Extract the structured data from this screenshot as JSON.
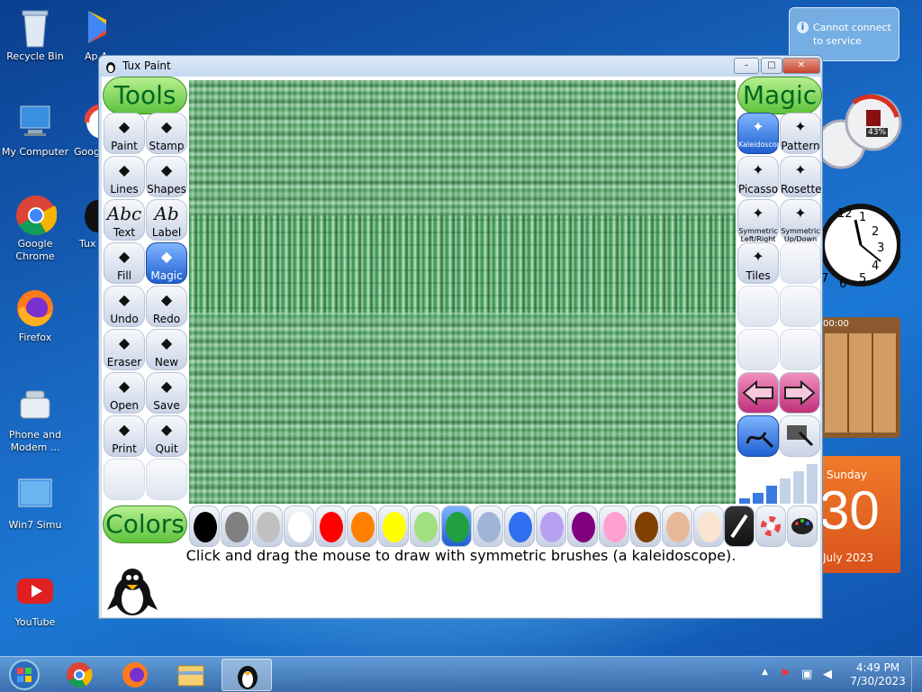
{
  "desktop": {
    "icons": [
      {
        "label": "Recycle Bin",
        "icon": "recycle-bin-icon"
      },
      {
        "label": "My Computer",
        "icon": "computer-icon"
      },
      {
        "label": "Google Chrome",
        "icon": "chrome-icon"
      },
      {
        "label": "Firefox",
        "icon": "firefox-icon"
      },
      {
        "label": "Phone and Modem ...",
        "icon": "phone-icon"
      },
      {
        "label": "Win7 Simu",
        "icon": "win7-icon"
      },
      {
        "label": "YouTube",
        "icon": "youtube-icon"
      },
      {
        "label": "Ap And",
        "icon": "play-store-icon"
      },
      {
        "label": "Goog",
        "icon": "google-icon"
      },
      {
        "label": "Tux",
        "icon": "tux-icon"
      }
    ],
    "notification": "Cannot connect to service",
    "gadgets": {
      "meter_value": "43%",
      "puzzle_time": "00:00",
      "calendar": {
        "weekday": "Sunday",
        "day": "30",
        "month_year": "July 2023"
      },
      "clock_numbers": [
        "12",
        "1",
        "2",
        "3",
        "4",
        "5",
        "6",
        "7"
      ]
    }
  },
  "window": {
    "title": "Tux Paint",
    "controls": {
      "minimize": "–",
      "maximize": "□",
      "close": "✕"
    }
  },
  "tools": {
    "header": "Tools",
    "items": [
      {
        "label": "Paint",
        "icon": "paint-brush-icon"
      },
      {
        "label": "Stamp",
        "icon": "stamp-icon"
      },
      {
        "label": "Lines",
        "icon": "lines-icon"
      },
      {
        "label": "Shapes",
        "icon": "shapes-icon"
      },
      {
        "label": "Text",
        "icon": "text-icon",
        "glyph": "Abc"
      },
      {
        "label": "Label",
        "icon": "label-icon",
        "glyph": "Ab"
      },
      {
        "label": "Fill",
        "icon": "fill-bucket-icon"
      },
      {
        "label": "Magic",
        "icon": "magic-wand-icon",
        "selected": true
      },
      {
        "label": "Undo",
        "icon": "undo-icon"
      },
      {
        "label": "Redo",
        "icon": "redo-icon"
      },
      {
        "label": "Eraser",
        "icon": "eraser-icon"
      },
      {
        "label": "New",
        "icon": "new-icon"
      },
      {
        "label": "Open",
        "icon": "open-icon"
      },
      {
        "label": "Save",
        "icon": "save-icon"
      },
      {
        "label": "Print",
        "icon": "print-icon"
      },
      {
        "label": "Quit",
        "icon": "quit-icon"
      }
    ]
  },
  "magic": {
    "header": "Magic",
    "items": [
      {
        "label": "Kaleidoscope",
        "icon": "kaleidoscope-icon",
        "selected": true
      },
      {
        "label": "Pattern",
        "icon": "pattern-icon"
      },
      {
        "label": "Picasso",
        "icon": "picasso-icon"
      },
      {
        "label": "Rosette",
        "icon": "rosette-icon"
      },
      {
        "label": "Symmetric Left/Right",
        "icon": "symmetric-left-right-icon"
      },
      {
        "label": "Symmetric Up/Down",
        "icon": "symmetric-up-down-icon"
      },
      {
        "label": "Tiles",
        "icon": "tiles-icon"
      }
    ]
  },
  "colors": {
    "header": "Colors",
    "swatches": [
      "#000000",
      "#808080",
      "#c0c0c0",
      "#ffffff",
      "#ff0000",
      "#ff8000",
      "#ffff00",
      "#a0e080",
      "#20a040",
      "#a0b4d8",
      "#3070f0",
      "#b8a0f0",
      "#800080",
      "#ffa0d0",
      "#804000",
      "#e8b898",
      "#f8e4d0"
    ],
    "selected_index": 8
  },
  "status": {
    "hint": "Click and drag the mouse to draw with symmetric brushes (a kaleidoscope)."
  },
  "taskbar": {
    "time": "4:49 PM",
    "date": "7/30/2023",
    "apps": [
      "start-orb-icon",
      "chrome-icon",
      "firefox-icon",
      "explorer-icon",
      "tux-paint-icon"
    ]
  }
}
